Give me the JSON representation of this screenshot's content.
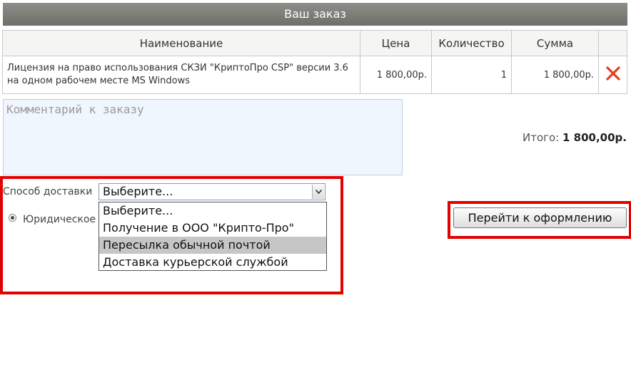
{
  "header": {
    "title": "Ваш заказ"
  },
  "table": {
    "columns": [
      "Наименование",
      "Цена",
      "Количество",
      "Сумма"
    ],
    "rows": [
      {
        "name": "Лицензия на право использования СКЗИ \"КриптоПро CSP\" версии 3.6 на одном рабочем месте MS Windows",
        "price": "1 800,00р.",
        "quantity": "1",
        "sum": "1 800,00р.",
        "delete_icon": "close-icon"
      }
    ]
  },
  "comment": {
    "placeholder": "Комментарий к заказу",
    "value": ""
  },
  "total": {
    "label": "Итого:",
    "value": "1 800,00р."
  },
  "delivery": {
    "label": "Способ доставки",
    "selected": "Выберите...",
    "options": [
      "Выберите...",
      "Получение в ООО \"Крипто-Про\"",
      "Пересылка обычной почтой",
      "Доставка курьерской службой"
    ],
    "hovered_option": "Пересылка обычной почтой"
  },
  "customer_type": {
    "radio_label": "Юридическое"
  },
  "checkout": {
    "button_label": "Перейти к оформлению"
  },
  "colors": {
    "header_bg": "#7a7a76",
    "highlight": "#e30000",
    "delete_icon": "#e63b1f",
    "comment_bg": "#f0f6fe"
  }
}
